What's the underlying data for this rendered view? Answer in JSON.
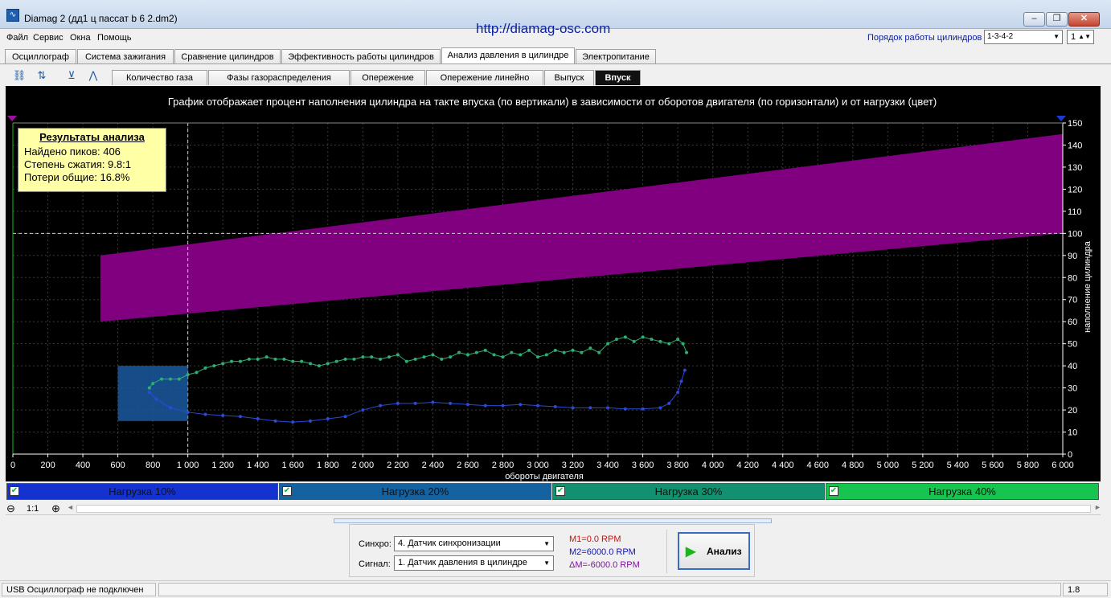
{
  "window": {
    "title": "Diamag 2 (дд1 ц пассат b 6 2.dm2)",
    "url": "http://diamag-osc.com",
    "min_label": "–",
    "max_label": "❐",
    "close_label": "✕"
  },
  "menu": [
    "Файл",
    "Сервис",
    "Окна",
    "Помощь"
  ],
  "cylinder_order": {
    "label": "Порядок работы цилиндров",
    "value": "1-3-4-2",
    "cylinder": "1"
  },
  "main_tabs": [
    "Осциллограф",
    "Система зажигания",
    "Сравнение цилиндров",
    "Эффективность работы цилиндров",
    "Анализ давления в цилиндре",
    "Электропитание"
  ],
  "active_main_tab": "Анализ давления в цилиндре",
  "toolbar_icons": [
    "cylinder-icon",
    "scale-1234-icon",
    "auto-icon",
    "peaks-icon"
  ],
  "toolbar_icon_glyphs": [
    "⛓",
    "⇅",
    "⊻",
    "⋀"
  ],
  "sub_tabs": [
    "Количество газа",
    "Фазы газораспределения",
    "Опережение",
    "Опережение линейно",
    "Выпуск",
    "Впуск"
  ],
  "active_sub_tab": "Впуск",
  "results": {
    "title": "Результаты анализа",
    "peaks": "Найдено пиков: 406",
    "compression": "Степень сжатия: 9.8:1",
    "losses": "Потери общие: 16.8%"
  },
  "load_bars": [
    {
      "label": "Нагрузка 10%",
      "color": "#1432d0"
    },
    {
      "label": "Нагрузка 20%",
      "color": "#1562a0"
    },
    {
      "label": "Нагрузка 30%",
      "color": "#129070"
    },
    {
      "label": "Нагрузка 40%",
      "color": "#18c450"
    }
  ],
  "zoom": {
    "minus": "⊖",
    "level": "1:1",
    "plus": "⊕"
  },
  "analysis": {
    "sync_label": "Синхро:",
    "sync_value": "4. Датчик синхронизации",
    "signal_label": "Сигнал:",
    "signal_value": "1. Датчик давления в цилиндре",
    "m1": "M1=0.0 RPM",
    "m2": "M2=6000.0 RPM",
    "dm": "ΔM=-6000.0 RPM",
    "button": "Анализ"
  },
  "status": {
    "left": "USB Осциллограф не подключен",
    "right": "1.8"
  },
  "chart_data": {
    "type": "scatter",
    "title": "График отображает процент наполнения цилиндра на такте впуска (по вертикали) в зависимости от оборотов двигателя (по горизонтали) и от нагрузки (цвет)",
    "xlabel": "обороты двигателя",
    "ylabel": "наполнение цилиндра",
    "xlim": [
      0,
      6000
    ],
    "ylim": [
      0,
      150
    ],
    "x_ticks": [
      "0",
      "200",
      "400",
      "600",
      "800",
      "1 000",
      "1 200",
      "1 400",
      "1 600",
      "1 800",
      "2 000",
      "2 200",
      "2 400",
      "2 600",
      "2 800",
      "3 000",
      "3 200",
      "3 400",
      "3 600",
      "3 800",
      "4 000",
      "4 200",
      "4 400",
      "4 600",
      "4 800",
      "5 000",
      "5 200",
      "5 400",
      "5 600",
      "5 800",
      "6 000"
    ],
    "y_ticks": [
      "0",
      "10",
      "20",
      "30",
      "40",
      "50",
      "60",
      "70",
      "80",
      "90",
      "100",
      "110",
      "120",
      "130",
      "140",
      "150"
    ],
    "reference_band": {
      "color": "#800080",
      "x": [
        500,
        6000
      ],
      "lower": [
        60,
        100
      ],
      "upper": [
        90,
        145
      ]
    },
    "reference_lines": {
      "x": 1000,
      "y": 100
    },
    "highlight_rect": {
      "x": [
        600,
        1000
      ],
      "y": [
        15,
        40
      ],
      "color": "#1a5aa0"
    },
    "series": [
      {
        "name": "Нагрузка 20%",
        "color": "#2a4ad8",
        "x": [
          780,
          820,
          900,
          1000,
          1100,
          1200,
          1300,
          1400,
          1500,
          1600,
          1700,
          1800,
          1900,
          2000,
          2100,
          2200,
          2300,
          2400,
          2500,
          2600,
          2700,
          2800,
          2900,
          3000,
          3100,
          3200,
          3300,
          3400,
          3500,
          3600,
          3700,
          3750,
          3800,
          3820,
          3840
        ],
        "y": [
          28,
          25,
          21,
          19,
          18,
          17.5,
          17,
          16,
          15,
          14.5,
          15,
          16,
          17,
          20,
          22,
          23,
          23,
          23.5,
          23,
          22.5,
          22,
          22,
          22.5,
          22,
          21.5,
          21,
          21,
          21,
          20.5,
          20.5,
          21,
          23,
          28,
          33,
          38
        ]
      },
      {
        "name": "Нагрузка 30%",
        "color": "#2fae72",
        "x": [
          780,
          800,
          850,
          900,
          950,
          1000,
          1050,
          1100,
          1150,
          1200,
          1250,
          1300,
          1350,
          1400,
          1450,
          1500,
          1550,
          1600,
          1650,
          1700,
          1750,
          1800,
          1850,
          1900,
          1950,
          2000,
          2050,
          2100,
          2150,
          2200,
          2250,
          2300,
          2350,
          2400,
          2450,
          2500,
          2550,
          2600,
          2650,
          2700,
          2750,
          2800,
          2850,
          2900,
          2950,
          3000,
          3050,
          3100,
          3150,
          3200,
          3250,
          3300,
          3350,
          3400,
          3450,
          3500,
          3550,
          3600,
          3650,
          3700,
          3750,
          3800,
          3830,
          3850
        ],
        "y": [
          30,
          32,
          34,
          34,
          34,
          36,
          37,
          39,
          40,
          41,
          42,
          42,
          43,
          43,
          44,
          43,
          43,
          42,
          42,
          41,
          40,
          41,
          42,
          43,
          43,
          44,
          44,
          43,
          44,
          45,
          42,
          43,
          44,
          45,
          43,
          44,
          46,
          45,
          46,
          47,
          45,
          44,
          46,
          45,
          47,
          44,
          45,
          47,
          46,
          47,
          46,
          48,
          46,
          50,
          52,
          53,
          51,
          53,
          52,
          51,
          50,
          52,
          50,
          46
        ]
      }
    ]
  }
}
